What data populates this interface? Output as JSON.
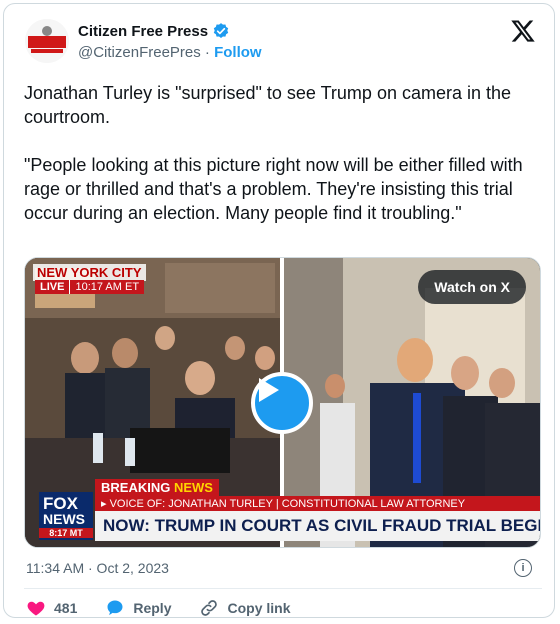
{
  "author": {
    "name": "Citizen Free Press",
    "handle": "@CitizenFreePres",
    "separator": " · ",
    "follow_label": "Follow",
    "verified_color": "#1d9bf0"
  },
  "tweet": {
    "text": "Jonathan Turley is \"surprised\" to see Trump on camera in the courtroom.\n\n\"People looking at this picture right now will be either filled with rage or thrilled and that's a problem. They're insisting this trial occur during an election. Many people find it troubling.\""
  },
  "media": {
    "watch_label": "Watch on X",
    "location": "NEW YORK CITY",
    "live_label": "LIVE",
    "live_time": "10:17 AM ET",
    "breaking_1": "BREAKING",
    "breaking_2": "NEWS",
    "voice_text": "▸ VOICE OF: JONATHAN TURLEY | CONSTITUTIONAL LAW ATTORNEY",
    "headline": "NOW: TRUMP IN COURT AS CIVIL FRAUD TRIAL BEGINS",
    "logo_1": "FOX",
    "logo_2": "NEWS",
    "logo_time": "8:17 MT"
  },
  "meta": {
    "timestamp": "11:34 AM · Oct 2, 2023"
  },
  "actions": {
    "like_count": "481",
    "reply_label": "Reply",
    "copy_label": "Copy link",
    "like_color": "#f91880",
    "reply_color": "#1d9bf0"
  }
}
